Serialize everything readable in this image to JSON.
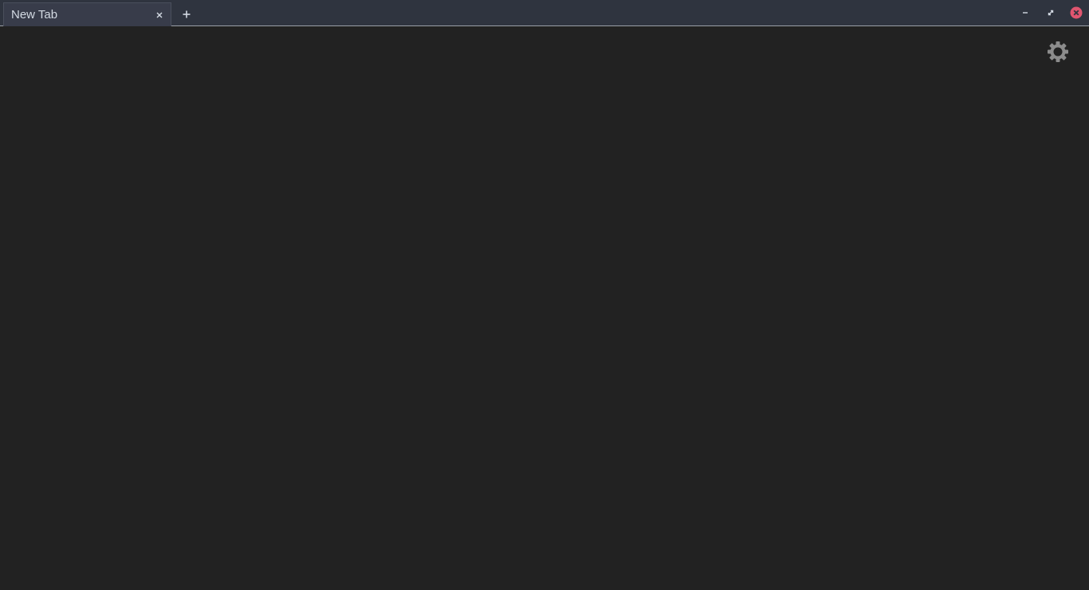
{
  "browser": {
    "tabs": [
      {
        "label": "New Tab",
        "close_icon": "close-icon"
      }
    ],
    "new_tab_icon": "plus-icon",
    "window_controls": {
      "minimize_icon": "minimize-icon",
      "maximize_icon": "restore-icon",
      "close_icon": "close-circle-icon",
      "close_color": "#e0556f"
    }
  },
  "page": {
    "settings_icon": "gear-icon"
  },
  "colors": {
    "titlebar": "#2f343f",
    "tab_active": "#383c4a",
    "content_background": "#222222",
    "text": "#d3dae3",
    "gear": "#8c8c8c"
  }
}
